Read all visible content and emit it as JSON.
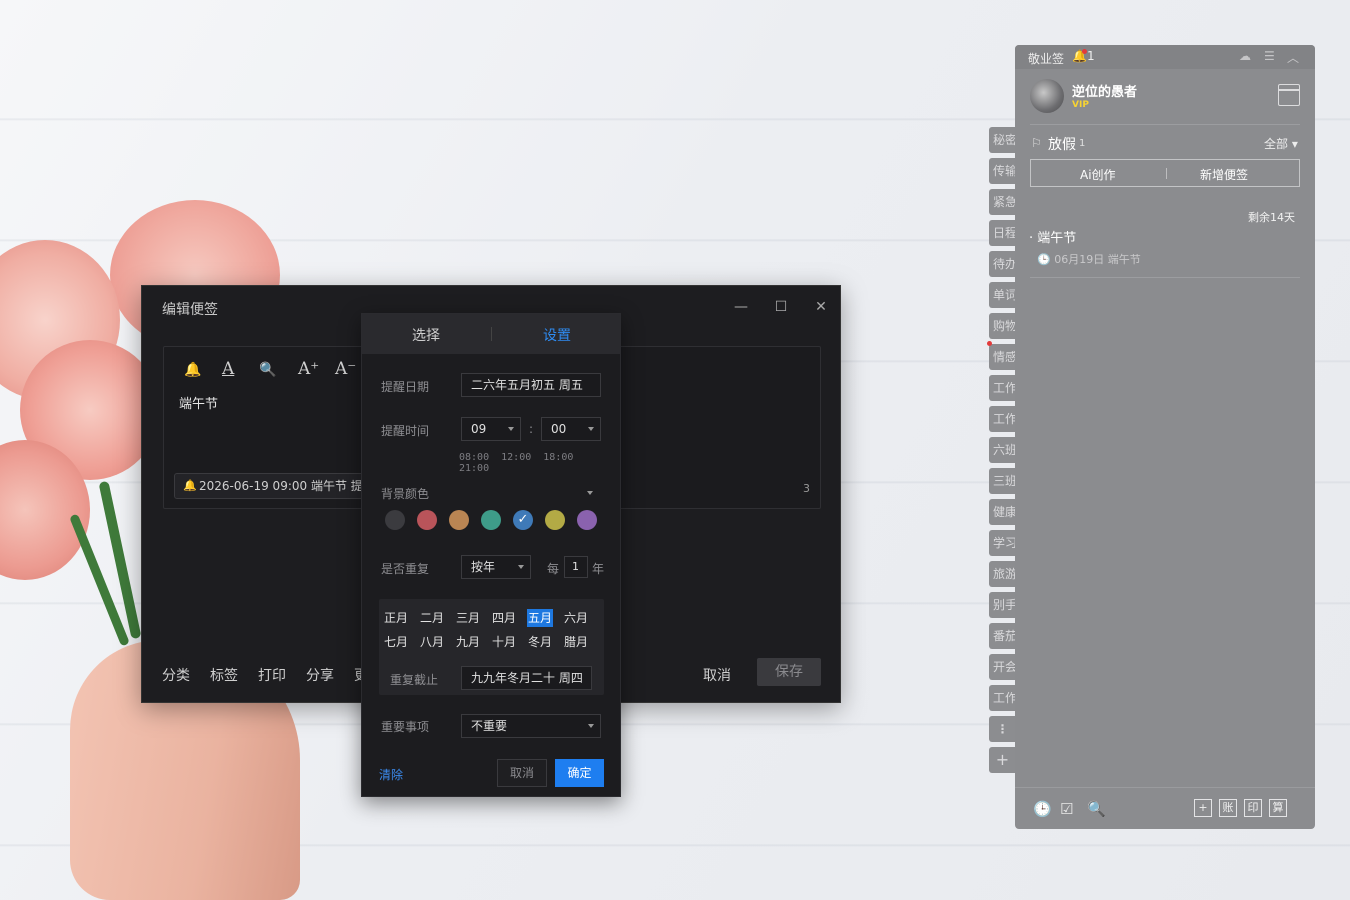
{
  "edit_window": {
    "title": "编辑便签",
    "minimize": "—",
    "maximize": "☐",
    "close": "✕",
    "toolbar": [
      "🔔",
      "A",
      "🔍",
      "A⁺",
      "A⁻"
    ],
    "content": "端午节",
    "reminder_chip": "2026-06-19 09:00 端午节 提醒",
    "char_count": "3",
    "bottom_actions": [
      "分类",
      "标签",
      "打印",
      "分享",
      "更"
    ],
    "cancel_label": "取消",
    "save_label": "保存"
  },
  "popup": {
    "tabs": [
      "选择",
      "设置"
    ],
    "active_tab_color": "#2f8cf2",
    "remind_date_label": "提醒日期",
    "remind_date_value": "二六年五月初五 周五",
    "remind_time_label": "提醒时间",
    "hour": "09",
    "minute": "00",
    "time_separator": ":",
    "quick_times": [
      "08:00",
      "12:00",
      "18:00",
      "21:00"
    ],
    "bg_color_label": "背景颜色",
    "colors": [
      "#3b3b3f",
      "#b9545a",
      "#b98553",
      "#3e9c89",
      "#3f7ab8",
      "#b3aa45",
      "#8a62ae"
    ],
    "selected_color_index": 4,
    "repeat_label": "是否重复",
    "repeat_mode": "按年",
    "every_label": "每",
    "every_value": "1",
    "unit_label": "年",
    "months": [
      "正月",
      "二月",
      "三月",
      "四月",
      "五月",
      "六月",
      "七月",
      "八月",
      "九月",
      "十月",
      "冬月",
      "腊月"
    ],
    "selected_month_index": 4,
    "repeat_end_label": "重复截止",
    "repeat_end_value": "九九年冬月二十 周四",
    "important_label": "重要事项",
    "important_value": "不重要",
    "clear_label": "清除",
    "cancel_label": "取消",
    "ok_label": "确定"
  },
  "side_tabs": [
    "秘密",
    "传输",
    "紧急",
    "日程",
    "待办",
    "单词",
    "购物",
    "情感",
    "工作",
    "工作",
    "六班",
    "三班",
    "健康",
    "学习",
    "旅游",
    "别手",
    "番茄",
    "开会",
    "工作",
    "⋮",
    "+"
  ],
  "sidebar": {
    "app_name": "敬业签",
    "notif_count": "1",
    "username": "逆位的愚者",
    "vip_label": "VIP",
    "category": "放假",
    "category_count": "1",
    "filter_all": "全部",
    "ai_label": "Ai创作",
    "new_note_label": "新增便签",
    "days_left": "剩余14天",
    "note_title": "端午节",
    "note_meta": "06月19日 端午节",
    "bottom_icons": [
      "🕒",
      "☑",
      "🔍"
    ],
    "bottom_squares": [
      "+",
      "账",
      "印",
      "算"
    ]
  }
}
